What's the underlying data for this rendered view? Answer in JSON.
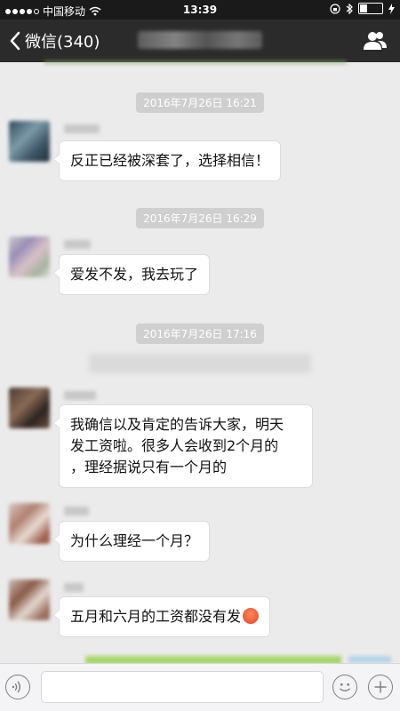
{
  "status": {
    "carrier": "中国移动",
    "time": "13:39"
  },
  "nav": {
    "back_label": "微信(340)",
    "title": ""
  },
  "messages": [
    {
      "timestamp": "2016年7月26日 16:21",
      "text": "反正已经被深套了，选择相信！"
    },
    {
      "timestamp": "2016年7月26日 16:29",
      "text": "爱发不发，我去玩了"
    },
    {
      "timestamp": "2016年7月26日 17:16",
      "text_line1": "我确信以及肯定的告诉大家，明天",
      "text_line2": "发工资啦。很多人会收到2个月的",
      "text_line3": "，理经据说只有一个月的"
    },
    {
      "text": "为什么理经一个月？"
    },
    {
      "text": "五月和六月的工资都没有发"
    }
  ],
  "input": {
    "placeholder": "",
    "value": ""
  },
  "colors": {
    "navbar": "#2b2b2b",
    "background": "#ebebeb",
    "bubble": "#ffffff"
  },
  "icons": [
    "back-chevron-icon",
    "people-icon",
    "voice-icon",
    "emoji-icon",
    "plus-icon",
    "wifi-icon",
    "lock-icon",
    "bluetooth-icon",
    "battery-icon"
  ]
}
